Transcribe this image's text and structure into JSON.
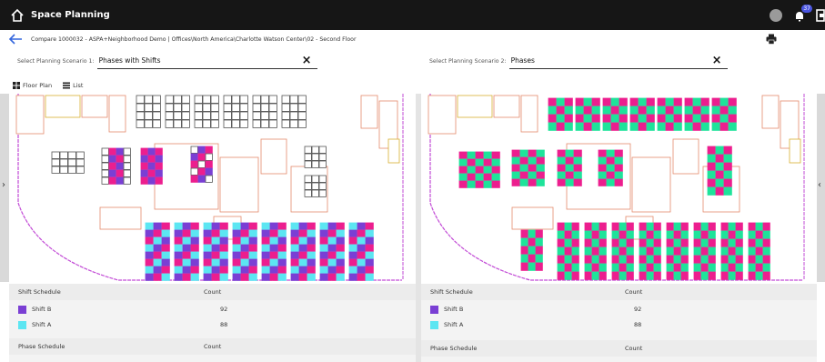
{
  "app": {
    "title": "Space Planning",
    "notification_count": "37"
  },
  "breadcrumb": {
    "text": "Compare  1000032 - ASPA+Neighborhood Demo | Offices\\North America\\Charlotte Watson Center\\02 - Second Floor"
  },
  "scenario1": {
    "label": "Select Planning Scenario 1:",
    "value": "Phases with Shifts"
  },
  "scenario2": {
    "label": "Select Planning Scenario 2:",
    "value": "Phases"
  },
  "view_tabs": {
    "floor_plan": "Floor Plan",
    "list": "List"
  },
  "colors": {
    "shift_b": "#7a3fd4",
    "shift_a": "#5ce6f2",
    "phase_pink": "#ec1e8e",
    "phase_green": "#1ee39a",
    "wall": "#e58a6c"
  },
  "left_stats": {
    "shift_header": "Shift Schedule",
    "count_header": "Count",
    "rows": [
      {
        "label": "Shift B",
        "count": "92"
      },
      {
        "label": "Shift A",
        "count": "88"
      }
    ],
    "phase_header": "Phase Schedule",
    "phase_count_header": "Count"
  },
  "right_stats": {
    "shift_header": "Shift Schedule",
    "count_header": "Count",
    "rows": [
      {
        "label": "Shift B",
        "count": "92"
      },
      {
        "label": "Shift A",
        "count": "88"
      }
    ],
    "phase_header": "Phase Schedule",
    "phase_count_header": "Count"
  }
}
